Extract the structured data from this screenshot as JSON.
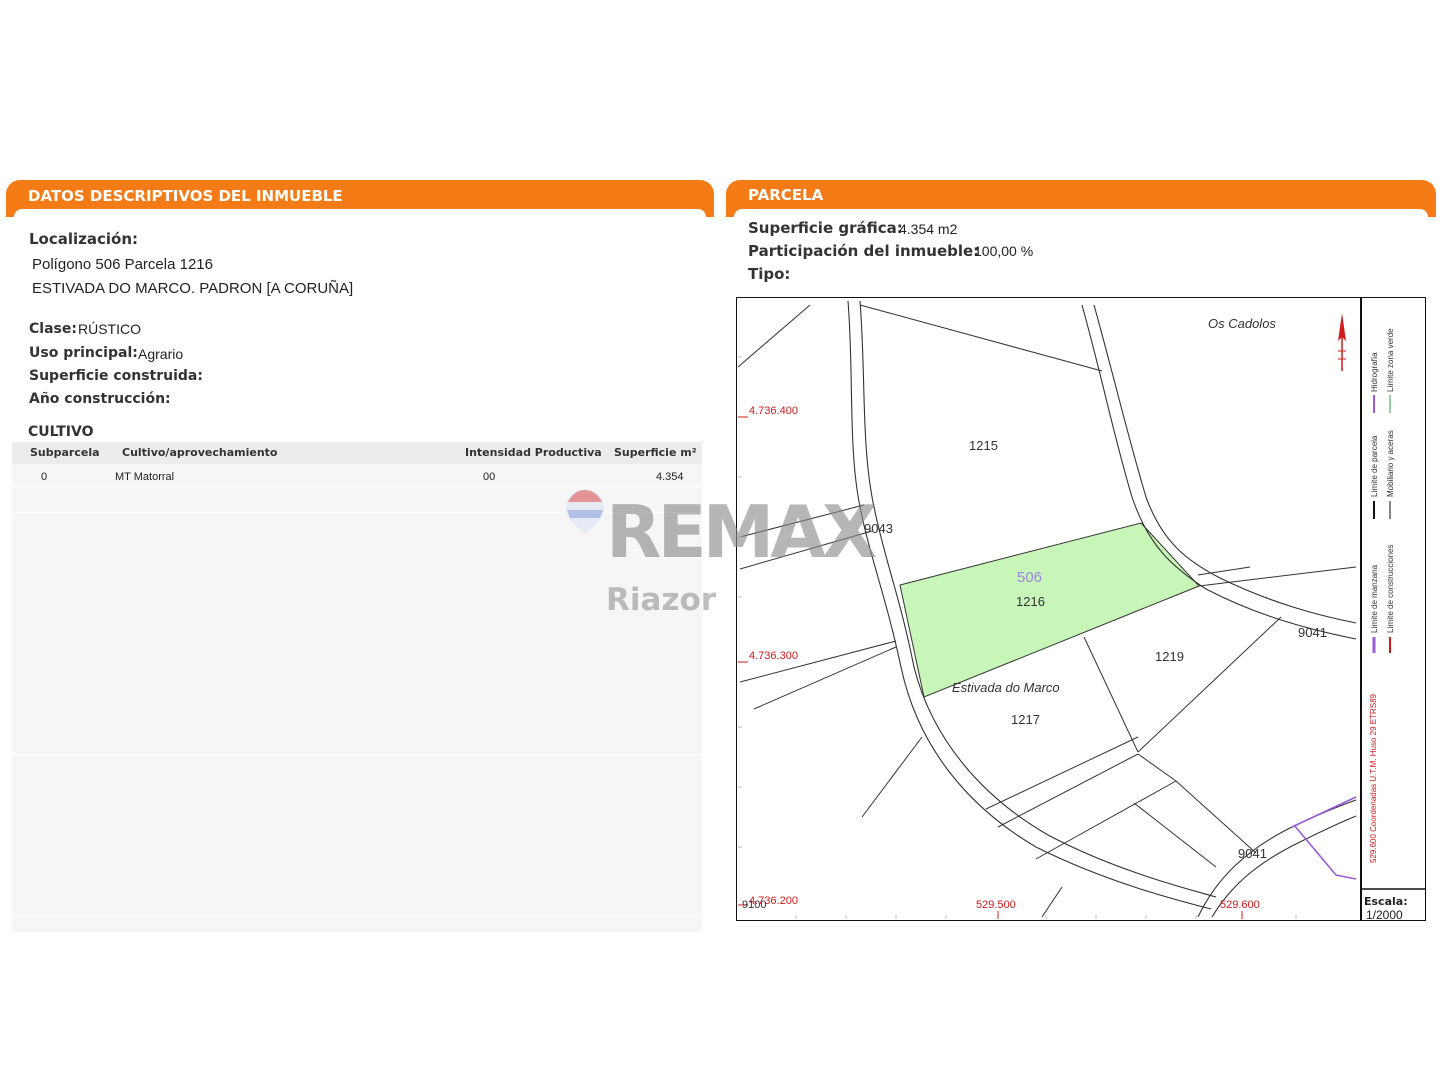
{
  "left_panel": {
    "header": "DATOS DESCRIPTIVOS DEL INMUEBLE",
    "localizacion_label": "Localización:",
    "localizacion_line1": "Polígono 506 Parcela 1216",
    "localizacion_line2": "ESTIVADA DO MARCO. PADRON [A CORUÑA]",
    "clase_label": "Clase:",
    "clase_value": "RÚSTICO",
    "uso_label": "Uso principal:",
    "uso_value": "Agrario",
    "superficie_construida_label": "Superficie construida:",
    "ano_construccion_label": "Año construcción:",
    "cultivo_title": "CULTIVO",
    "table": {
      "headers": [
        "Subparcela",
        "Cultivo/aprovechamiento",
        "Intensidad Productiva",
        "Superficie m²"
      ],
      "rows": [
        [
          "0",
          "MT Matorral",
          "00",
          "4.354"
        ]
      ]
    }
  },
  "right_panel": {
    "header": "PARCELA",
    "superficie_grafica_label": "Superficie gráfica:",
    "superficie_grafica_value": "4.354 m2",
    "participacion_label": "Participación del inmueble:",
    "participacion_value": "100,00 %",
    "tipo_label": "Tipo:"
  },
  "map": {
    "place_name": "Os Cadolos",
    "street_name": "Estivada do Marco",
    "highlight_polygon": "506",
    "parcels": [
      "1215",
      "1216",
      "1219",
      "1217"
    ],
    "roads": [
      "9043",
      "9041",
      "9041",
      "9100"
    ],
    "y_coords": [
      "4.736.400",
      "4.736.300",
      "4.736.200"
    ],
    "x_coords": [
      "529.500",
      "529.600"
    ],
    "legend": {
      "hidrografia": "Hidrografía",
      "limite_zona_verde": "Límite zona verde",
      "limite_parcela": "Límite de parcela",
      "mobiliario": "Mobiliario y aceras",
      "limite_manzana": "Límite de manzana",
      "limite_construcciones": "Límite de construcciones",
      "coordenadas": "529.600 Coordenadas U.T.M. Huso 29 ETRS89"
    },
    "escala_label": "Escala:",
    "escala_value": "1/2000",
    "colors": {
      "parcel_fill": "#c8f5b8",
      "coord_red": "#d11a1a",
      "legend_purple": "#9a5bd6",
      "legend_green": "#2aa34a"
    }
  },
  "watermark": {
    "brand": "REMAX",
    "sub": "Riazor"
  }
}
